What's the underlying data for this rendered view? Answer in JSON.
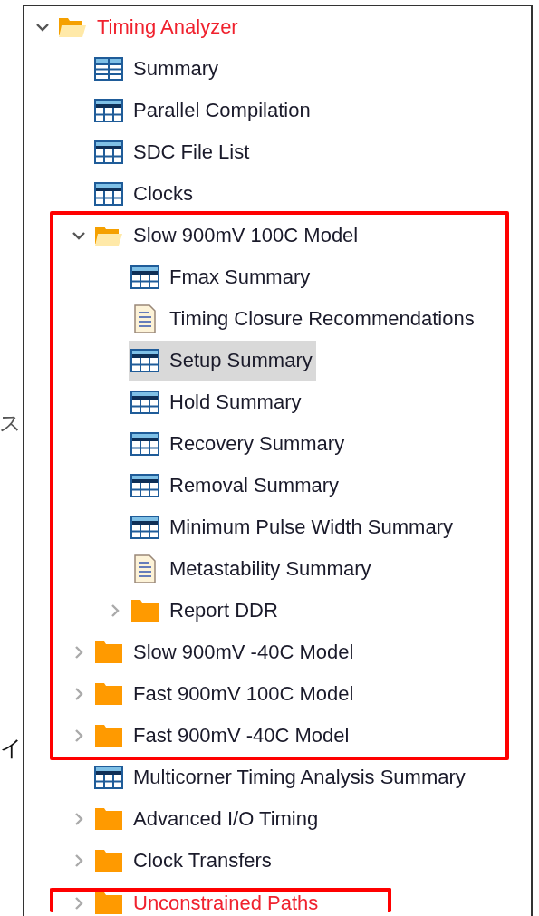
{
  "side_texts": [
    "ス",
    "イ"
  ],
  "tree": [
    {
      "kind": "folder",
      "label": "Timing Analyzer",
      "expanded": true,
      "highlighted": true,
      "selected": false,
      "children": [
        {
          "kind": "grid",
          "label": "Summary",
          "highlighted": false,
          "selected": false
        },
        {
          "kind": "table",
          "label": "Parallel Compilation",
          "highlighted": false,
          "selected": false
        },
        {
          "kind": "table",
          "label": "SDC File List",
          "highlighted": false,
          "selected": false
        },
        {
          "kind": "table",
          "label": "Clocks",
          "highlighted": false,
          "selected": false
        },
        {
          "kind": "annotation_box",
          "items": [
            {
              "kind": "folder",
              "label": "Slow 900mV 100C Model",
              "expanded": true,
              "highlighted": false,
              "selected": false,
              "children": [
                {
                  "kind": "table",
                  "label": "Fmax Summary",
                  "highlighted": false,
                  "selected": false
                },
                {
                  "kind": "document",
                  "label": "Timing Closure Recommendations",
                  "highlighted": false,
                  "selected": false
                },
                {
                  "kind": "table",
                  "label": "Setup Summary",
                  "highlighted": false,
                  "selected": true
                },
                {
                  "kind": "table",
                  "label": "Hold Summary",
                  "highlighted": false,
                  "selected": false
                },
                {
                  "kind": "table",
                  "label": "Recovery Summary",
                  "highlighted": false,
                  "selected": false
                },
                {
                  "kind": "table",
                  "label": "Removal Summary",
                  "highlighted": false,
                  "selected": false
                },
                {
                  "kind": "table",
                  "label": "Minimum Pulse Width Summary",
                  "highlighted": false,
                  "selected": false
                },
                {
                  "kind": "document",
                  "label": "Metastability Summary",
                  "highlighted": false,
                  "selected": false
                },
                {
                  "kind": "folder",
                  "label": "Report DDR",
                  "expanded": false,
                  "highlighted": false,
                  "selected": false
                }
              ]
            },
            {
              "kind": "folder",
              "label": "Slow 900mV -40C Model",
              "expanded": false,
              "highlighted": false,
              "selected": false
            },
            {
              "kind": "folder",
              "label": "Fast 900mV 100C Model",
              "expanded": false,
              "highlighted": false,
              "selected": false
            },
            {
              "kind": "folder",
              "label": "Fast 900mV -40C Model",
              "expanded": false,
              "highlighted": false,
              "selected": false
            }
          ]
        },
        {
          "kind": "table",
          "label": "Multicorner Timing Analysis Summary",
          "highlighted": false,
          "selected": false
        },
        {
          "kind": "folder",
          "label": "Advanced I/O Timing",
          "expanded": false,
          "highlighted": false,
          "selected": false
        },
        {
          "kind": "folder",
          "label": "Clock Transfers",
          "expanded": false,
          "highlighted": false,
          "selected": false
        },
        {
          "kind": "annotation_box",
          "items": [
            {
              "kind": "folder",
              "label": "Unconstrained Paths",
              "expanded": false,
              "highlighted": true,
              "selected": false
            }
          ]
        }
      ]
    }
  ]
}
